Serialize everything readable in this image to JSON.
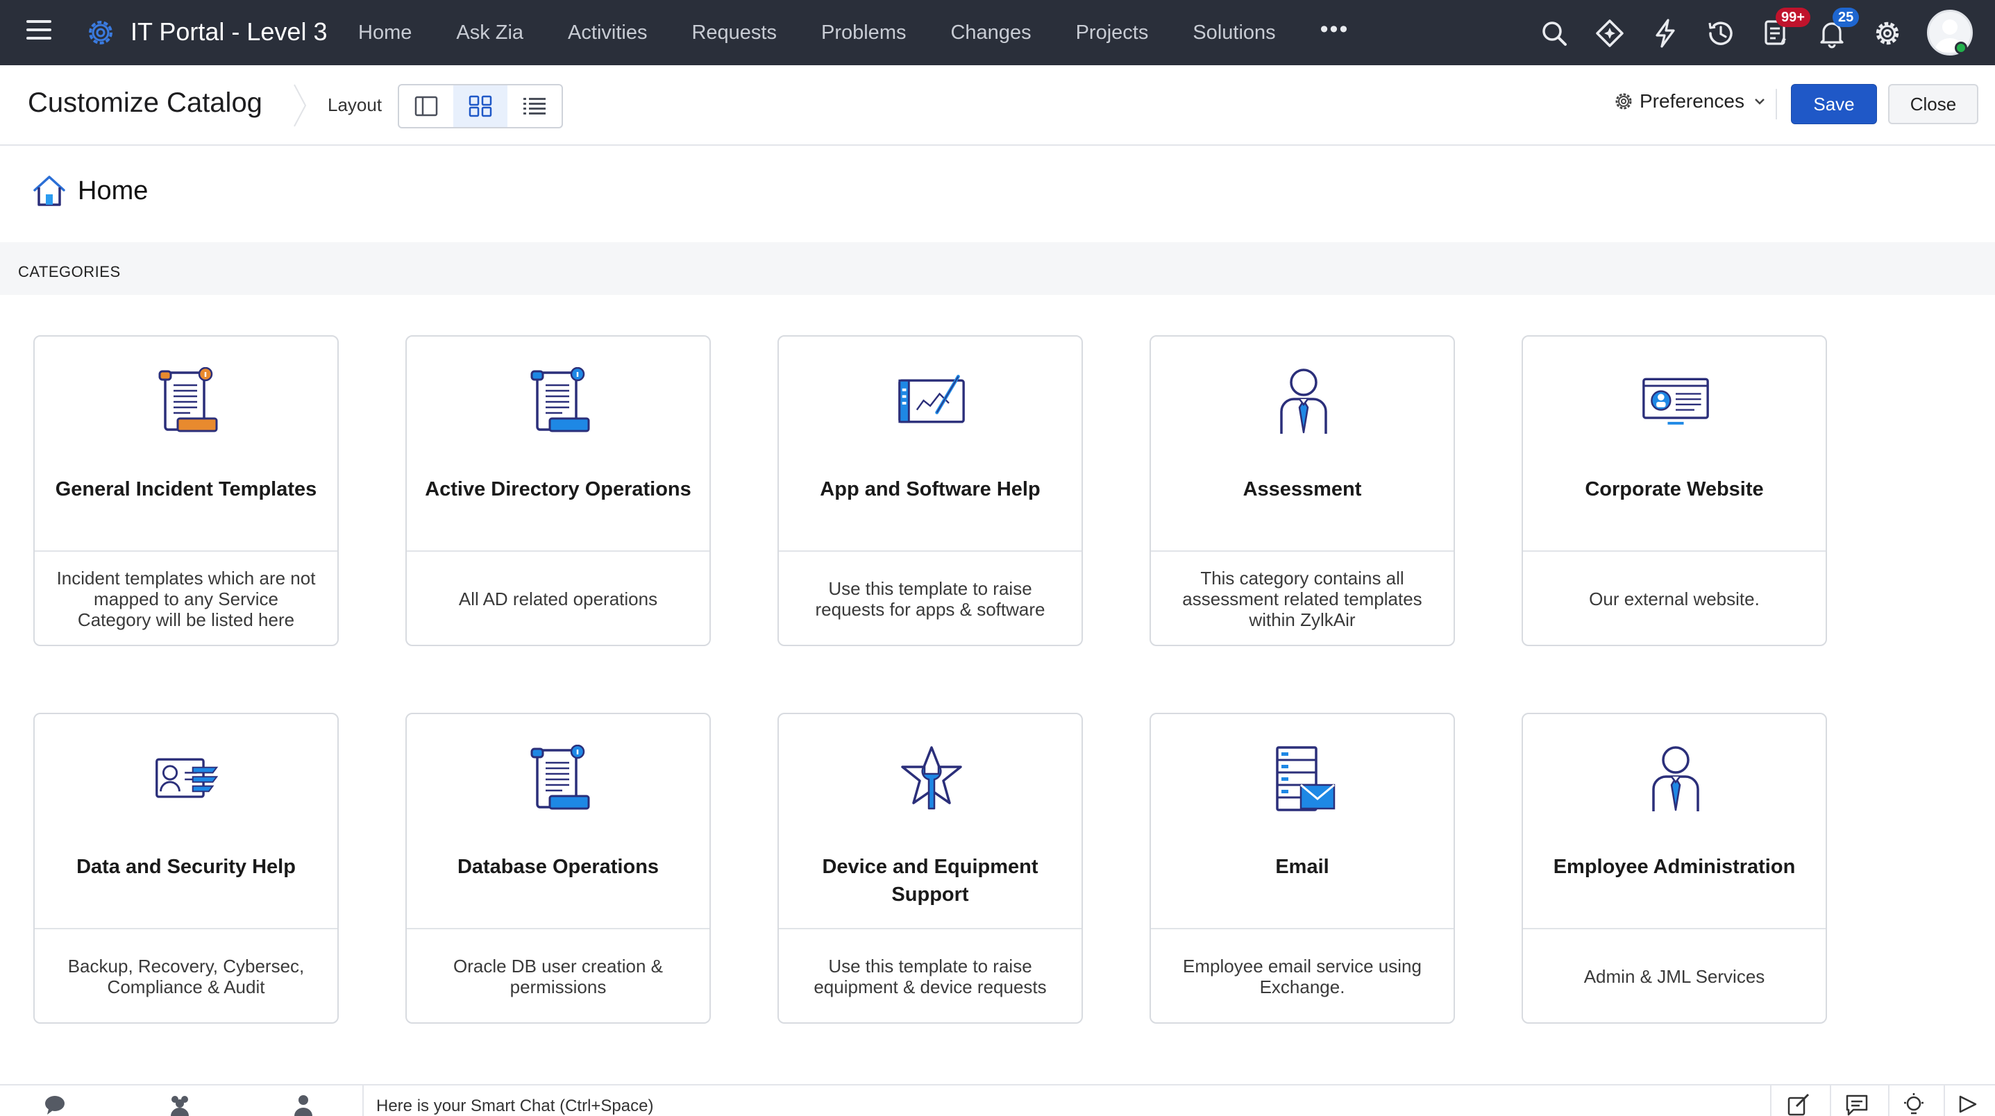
{
  "header": {
    "portal_title": "IT Portal - Level 3",
    "nav": [
      "Home",
      "Ask Zia",
      "Activities",
      "Requests",
      "Problems",
      "Changes",
      "Projects",
      "Solutions"
    ],
    "more_label": "•••",
    "icons": [
      "search-icon",
      "zia-icon",
      "quick-actions-icon",
      "history-icon",
      "tasks-icon",
      "notifications-icon",
      "settings-icon"
    ],
    "tasks_badge": "99+",
    "notifications_badge": "25"
  },
  "subheader": {
    "title": "Customize Catalog",
    "layout_label": "Layout",
    "preferences_label": "Preferences",
    "save_label": "Save",
    "close_label": "Close"
  },
  "breadcrumb": {
    "home_label": "Home"
  },
  "categories": {
    "heading": "CATEGORIES",
    "items": [
      {
        "name": "General Incident Templates",
        "desc": "Incident templates which are not mapped to any Service Category will be listed here",
        "icon": "scroll-icon"
      },
      {
        "name": "Active Directory Operations",
        "desc": "All AD related operations",
        "icon": "scroll-icon"
      },
      {
        "name": "App and Software Help",
        "desc": "Use this template to raise requests for apps & software",
        "icon": "app-window-icon"
      },
      {
        "name": "Assessment",
        "desc": "This category contains all assessment related templates within ZylkAir",
        "icon": "person-icon"
      },
      {
        "name": "Corporate Website",
        "desc": "Our external website.",
        "icon": "website-icon"
      },
      {
        "name": "Data and Security Help",
        "desc": "Backup, Recovery, Cybersec, Compliance & Audit",
        "icon": "security-card-icon"
      },
      {
        "name": "Database Operations",
        "desc": "Oracle DB user creation & permissions",
        "icon": "scroll-icon"
      },
      {
        "name": "Device and Equipment Support",
        "desc": "Use this template to raise equipment & device requests",
        "icon": "wrench-star-icon"
      },
      {
        "name": "Email",
        "desc": "Employee email service using Exchange.",
        "icon": "email-server-icon"
      },
      {
        "name": "Employee Administration",
        "desc": "Admin & JML Services",
        "icon": "person-icon"
      }
    ]
  },
  "bottombar": {
    "smart_chat": "Here is your Smart Chat (Ctrl+Space)"
  },
  "colors": {
    "topbar": "#2a2f3a",
    "primary": "#1f58c7",
    "icon_blue": "#1e88e5",
    "icon_navy": "#2b2f7a",
    "icon_orange": "#e88a2e"
  }
}
